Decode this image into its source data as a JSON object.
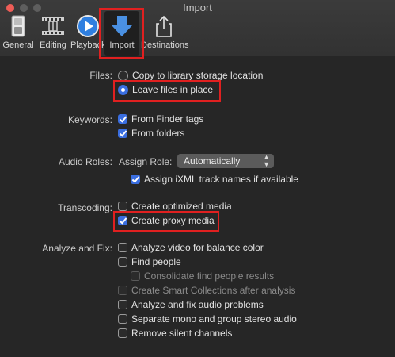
{
  "window": {
    "title": "Import"
  },
  "toolbar": {
    "items": [
      {
        "label": "General",
        "icon": "general-switch-icon"
      },
      {
        "label": "Editing",
        "icon": "film-editing-icon"
      },
      {
        "label": "Playback",
        "icon": "play-icon"
      },
      {
        "label": "Import",
        "icon": "import-arrow-icon",
        "selected": true
      },
      {
        "label": "Destinations",
        "icon": "share-icon"
      }
    ]
  },
  "files": {
    "label": "Files:",
    "copy_option": "Copy to library storage location",
    "leave_option": "Leave files in place",
    "selected": "Leave files in place"
  },
  "keywords": {
    "label": "Keywords:",
    "finder_tags": "From Finder tags",
    "folders": "From folders",
    "finder_tags_checked": true,
    "folders_checked": true
  },
  "audio_roles": {
    "label": "Audio Roles:",
    "assign_label": "Assign Role:",
    "assign_value": "Automatically",
    "ixml": "Assign iXML track names if available",
    "ixml_checked": true
  },
  "transcoding": {
    "label": "Transcoding:",
    "optimized": "Create optimized media",
    "proxy": "Create proxy media",
    "optimized_checked": false,
    "proxy_checked": true
  },
  "analyze": {
    "label": "Analyze and Fix:",
    "balance_color": "Analyze video for balance color",
    "find_people": "Find people",
    "consolidate": "Consolidate find people results",
    "smart_collections": "Create Smart Collections after analysis",
    "audio_problems": "Analyze and fix audio problems",
    "mono_stereo": "Separate mono and group stereo audio",
    "silent_channels": "Remove silent channels"
  },
  "colors": {
    "accent": "#3a6ee0",
    "highlight_box": "#e02020",
    "import_icon": "#4a90e2",
    "playback_icon": "#2f7fe0"
  }
}
